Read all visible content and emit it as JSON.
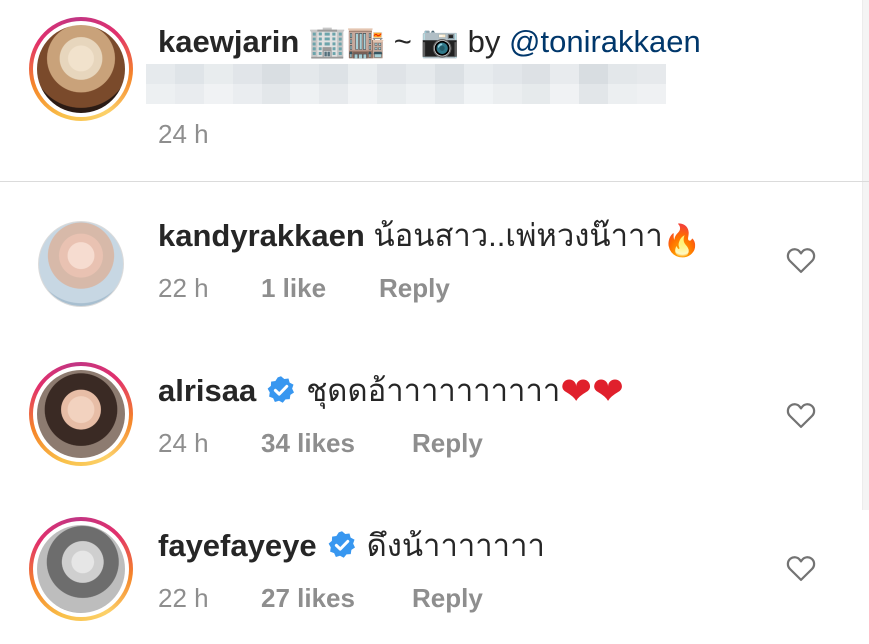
{
  "caption": {
    "username": "kaewjarin",
    "emoji_text": "🏢🏬 ~ 📷 by ",
    "mention": "@tonirakkaen",
    "time": "24 h"
  },
  "comments": [
    {
      "username": "kandyrakkaen",
      "verified": false,
      "text": "น้อนสาว..เพ่หวงน๊าาา",
      "emoji": "🔥",
      "time": "22 h",
      "likes": "1 like",
      "reply": "Reply"
    },
    {
      "username": "alrisaa",
      "verified": true,
      "text": "ชุดดอ้าาาาาาาาาา",
      "emoji": "❤❤",
      "time": "24 h",
      "likes": "34 likes",
      "reply": "Reply"
    },
    {
      "username": "fayefayeye",
      "verified": true,
      "text": "ดึงน้าาาาาาา",
      "emoji": "",
      "time": "22 h",
      "likes": "27 likes",
      "reply": "Reply"
    }
  ],
  "colors": {
    "text": "#262626",
    "meta": "#8e8e8e",
    "mention": "#00376b",
    "verified": "#3897f0",
    "divider": "#dbdbdb"
  },
  "icons": [
    "heart-outline-icon",
    "verified-badge-icon",
    "fire-emoji",
    "red-heart-emoji",
    "office-building-emoji",
    "department-store-emoji",
    "camera-emoji"
  ]
}
